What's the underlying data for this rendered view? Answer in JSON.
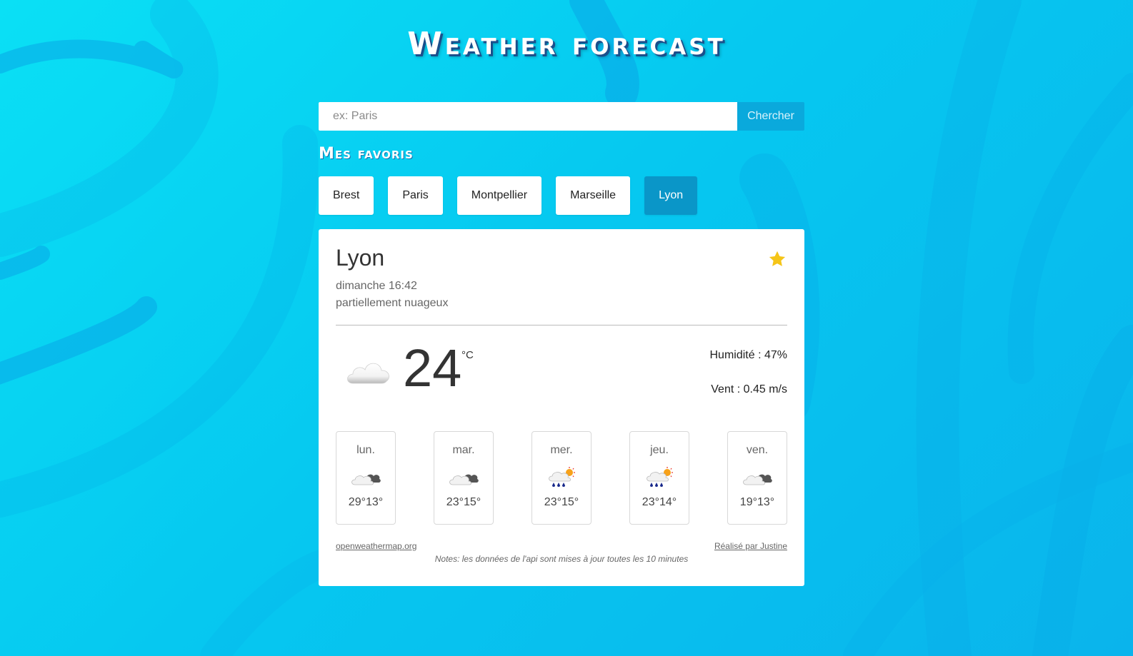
{
  "app": {
    "title": "Weather forecast"
  },
  "search": {
    "placeholder": "ex: Paris",
    "value": "",
    "button_label": "Chercher"
  },
  "favorites": {
    "heading": "Mes favoris",
    "items": [
      {
        "label": "Brest",
        "active": false
      },
      {
        "label": "Paris",
        "active": false
      },
      {
        "label": "Montpellier",
        "active": false
      },
      {
        "label": "Marseille",
        "active": false
      },
      {
        "label": "Lyon",
        "active": true
      }
    ]
  },
  "current": {
    "city": "Lyon",
    "favorite_icon": "star-icon",
    "datetime": "dimanche 16:42",
    "description": "partiellement nuageux",
    "icon": "cloud-icon",
    "temperature": "24",
    "unit": "°C",
    "humidity": "Humidité : 47%",
    "wind": "Vent : 0.45 m/s"
  },
  "forecast": [
    {
      "day": "lun.",
      "temps": "29°13°",
      "icon": "partly-cloudy-icon"
    },
    {
      "day": "mar.",
      "temps": "23°15°",
      "icon": "partly-cloudy-icon"
    },
    {
      "day": "mer.",
      "temps": "23°15°",
      "icon": "rain-sun-icon"
    },
    {
      "day": "jeu.",
      "temps": "23°14°",
      "icon": "rain-sun-icon"
    },
    {
      "day": "ven.",
      "temps": "19°13°",
      "icon": "partly-cloudy-icon"
    }
  ],
  "footer": {
    "source": "openweathermap.org",
    "credit": "Réalisé par Justine",
    "notes": "Notes: les données de l'api sont mises à jour toutes les 10 minutes"
  },
  "colors": {
    "background": "#06c8f0",
    "accent": "#0a96c8",
    "search_button": "#0aa9dc",
    "star": "#f5c518"
  }
}
